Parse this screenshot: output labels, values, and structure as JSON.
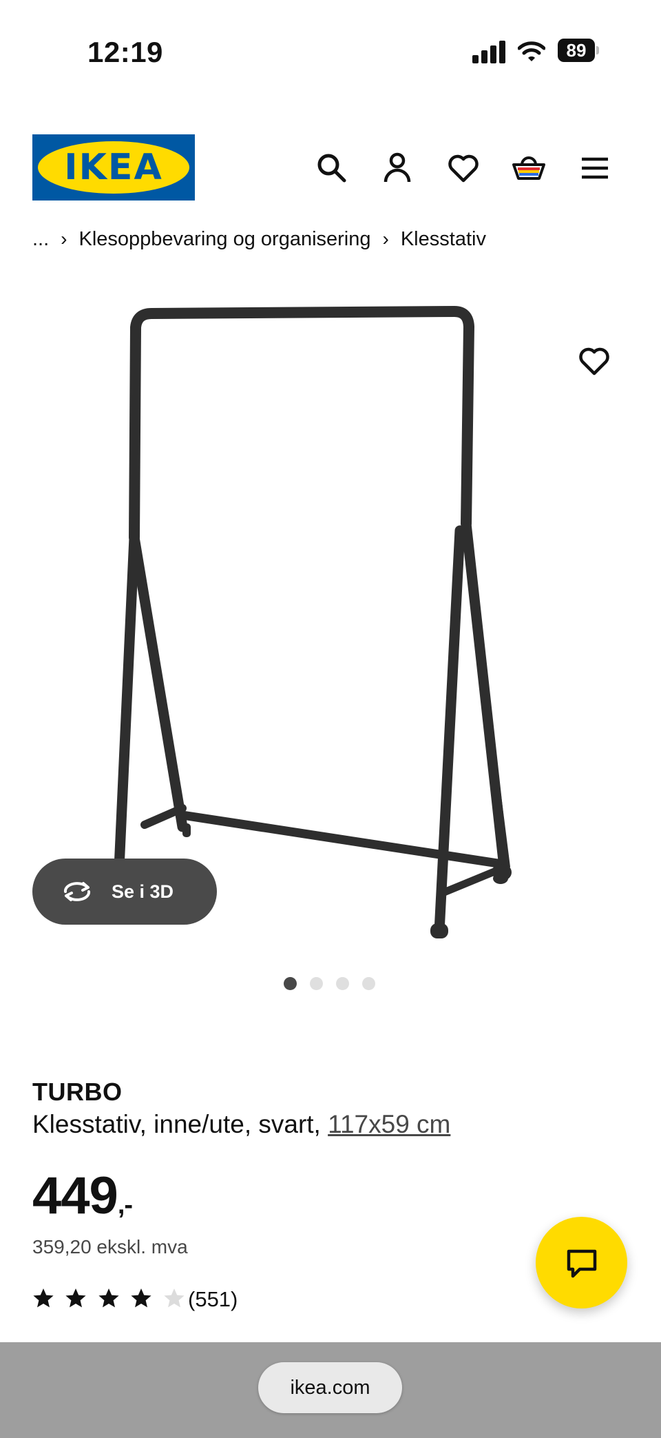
{
  "status_bar": {
    "time": "12:19",
    "battery": "89"
  },
  "header": {
    "logo_text": "IKEA",
    "icons": [
      "search-icon",
      "account-icon",
      "heart-icon",
      "basket-icon",
      "menu-icon"
    ]
  },
  "breadcrumb": {
    "items": [
      "...",
      "Klesoppbevaring og organisering",
      "Klesstativ"
    ]
  },
  "gallery": {
    "view_3d_label": "Se i 3D",
    "image_count": 4,
    "active_index": 0
  },
  "product": {
    "name": "TURBO",
    "description": "Klesstativ, inne/ute, svart, ",
    "dimensions": "117x59 cm",
    "price_main": "449",
    "price_suffix": ",-",
    "price_ex_vat": "359,20 ekskl. mva",
    "rating": 4,
    "rating_max": 5,
    "review_count": "(551)"
  },
  "browser": {
    "url": "ikea.com"
  },
  "colors": {
    "brand_blue": "#0058a3",
    "brand_yellow": "#ffdb00",
    "text": "#111111",
    "muted": "#484848"
  }
}
